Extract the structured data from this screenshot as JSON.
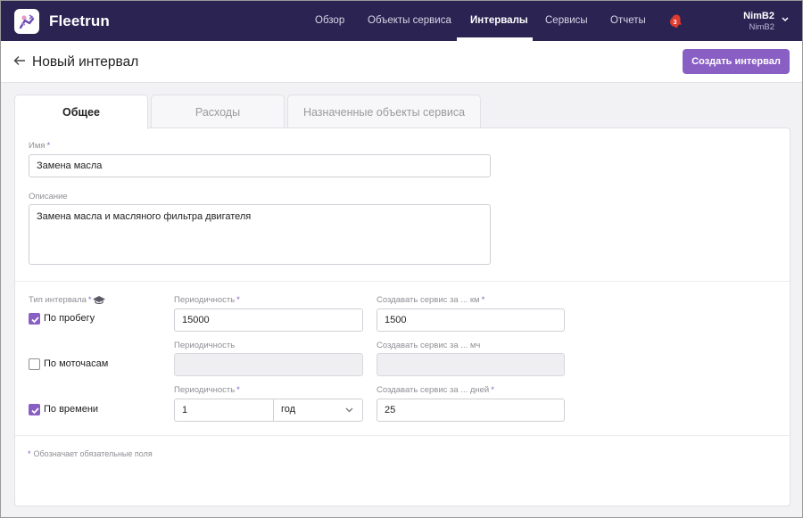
{
  "app": {
    "brand": "Fleetrun",
    "nav": [
      "Обзор",
      "Объекты сервиса",
      "Интервалы",
      "Сервисы",
      "Отчеты"
    ],
    "active_nav": "Интервалы",
    "notifications_count": "3",
    "user": {
      "name": "NimB2",
      "sub": "NimB2"
    }
  },
  "header": {
    "title": "Новый интервал",
    "create_button": "Создать интервал"
  },
  "tabs": [
    "Общее",
    "Расходы",
    "Назначенные объекты сервиса"
  ],
  "form": {
    "name_label": "Имя",
    "name_value": "Замена масла",
    "description_label": "Описание",
    "description_value": "Замена масла и масляного фильтра двигателя",
    "interval_type_label": "Тип интервала",
    "rows": [
      {
        "checked": true,
        "label": "По пробегу",
        "period_label": "Периодичность",
        "period_required": true,
        "period_value": "15000",
        "create_label": "Создавать сервис за ... км",
        "create_required": true,
        "create_value": "1500"
      },
      {
        "checked": false,
        "label": "По моточасам",
        "period_label": "Периодичность",
        "period_required": false,
        "period_value": "",
        "create_label": "Создавать сервис за ... мч",
        "create_required": false,
        "create_value": ""
      },
      {
        "checked": true,
        "label": "По времени",
        "period_label": "Периодичность",
        "period_required": true,
        "period_value": "1",
        "unit_value": "год",
        "create_label": "Создавать сервис за ... дней",
        "create_required": true,
        "create_value": "25"
      }
    ],
    "required_note": "Обозначает обязательные поля"
  },
  "colors": {
    "nav_bg": "#2b2453",
    "accent": "#8a5fc4",
    "badge": "#e03a2f"
  }
}
